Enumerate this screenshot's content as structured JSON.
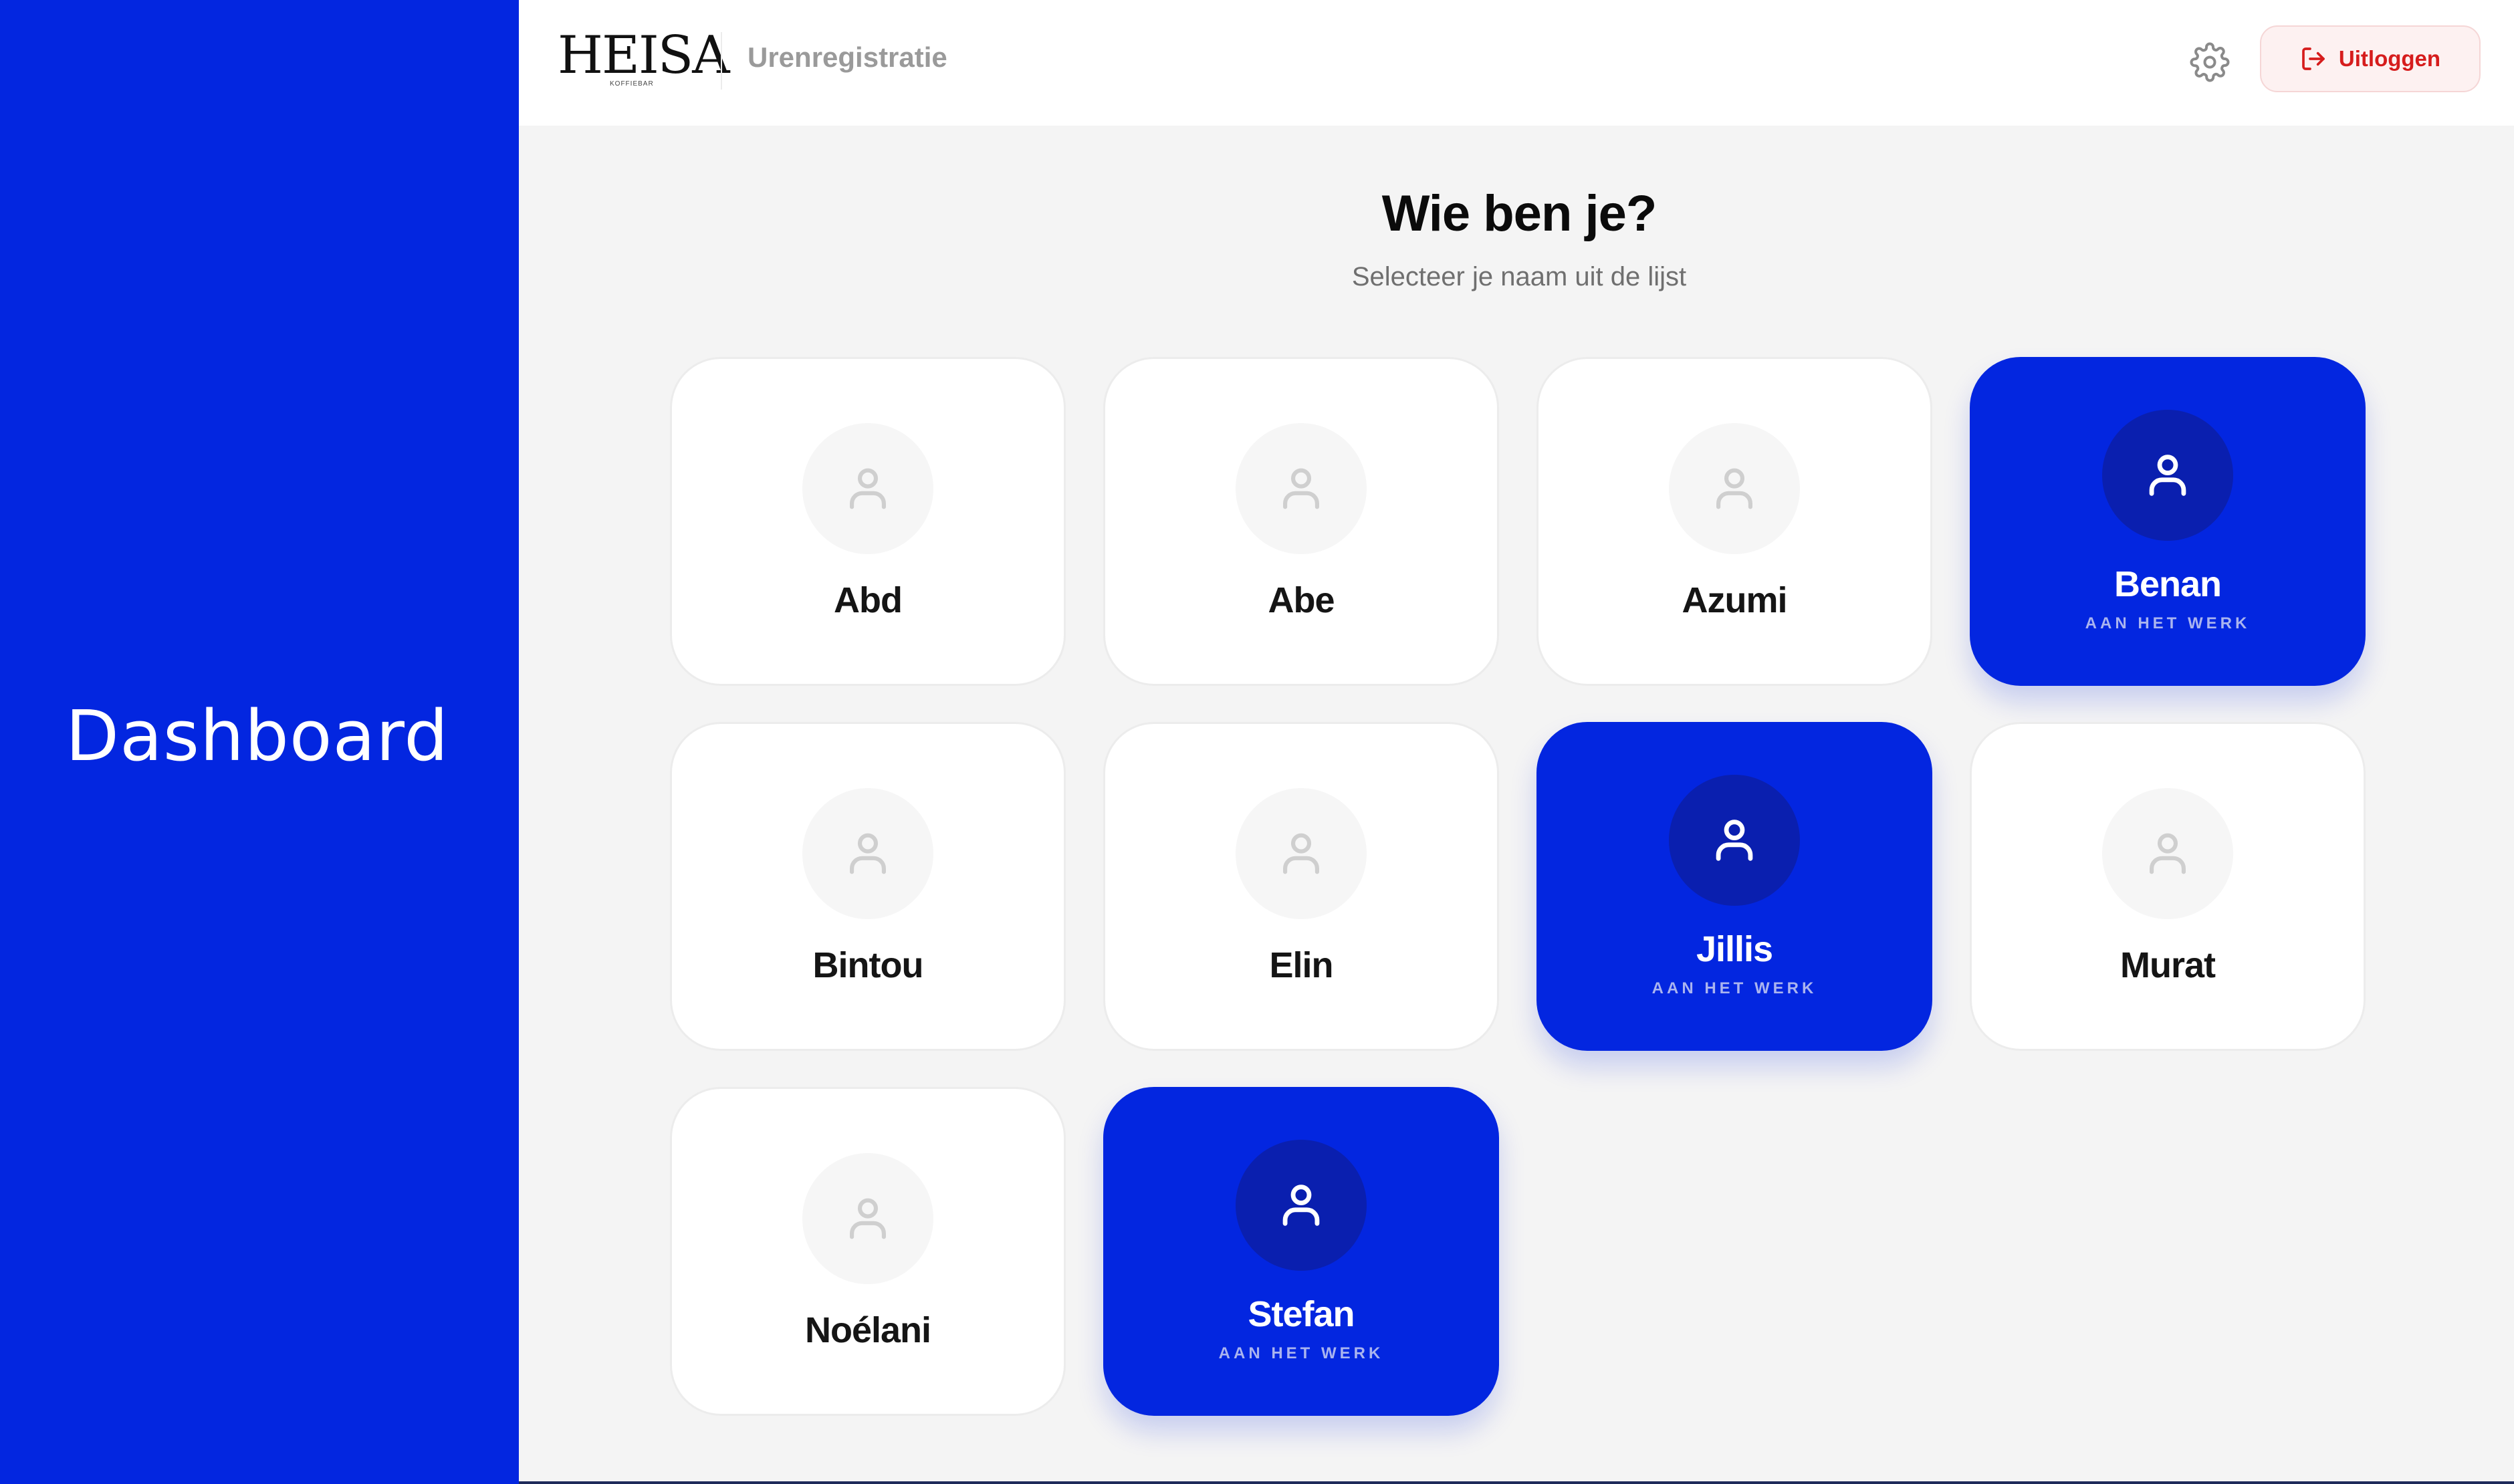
{
  "sidebar": {
    "title": "Dashboard"
  },
  "header": {
    "logo_text": "HEISA",
    "logo_sub": "KOFFIEBAR",
    "app_name": "Urenregistratie",
    "settings_icon": "gear-icon",
    "logout_label": "Uitloggen",
    "logout_icon": "logout-icon"
  },
  "main": {
    "title": "Wie ben je?",
    "subtitle": "Selecteer je naam uit de lijst"
  },
  "employees": [
    {
      "name": "Abd",
      "active": false,
      "status": ""
    },
    {
      "name": "Abe",
      "active": false,
      "status": ""
    },
    {
      "name": "Azumi",
      "active": false,
      "status": ""
    },
    {
      "name": "Benan",
      "active": true,
      "status": "AAN HET WERK"
    },
    {
      "name": "Bintou",
      "active": false,
      "status": ""
    },
    {
      "name": "Elin",
      "active": false,
      "status": ""
    },
    {
      "name": "Jillis",
      "active": true,
      "status": "AAN HET WERK"
    },
    {
      "name": "Murat",
      "active": false,
      "status": ""
    },
    {
      "name": "Noélani",
      "active": false,
      "status": ""
    },
    {
      "name": "Stefan",
      "active": true,
      "status": "AAN HET WERK"
    }
  ],
  "colors": {
    "brand_blue": "#0326e0",
    "logout_red": "#d61c1c",
    "background": "#f4f4f4"
  }
}
